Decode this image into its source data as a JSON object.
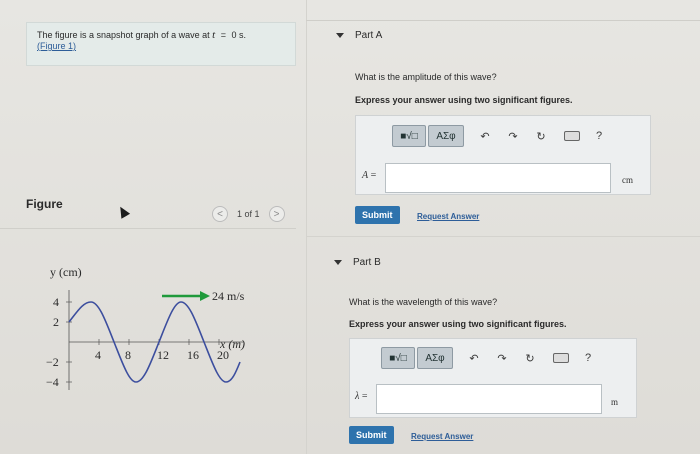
{
  "problem": {
    "text_prefix": "The figure is a snapshot graph of a wave at",
    "t_var": "t",
    "eq": "=",
    "t_value": "0 s.",
    "figure_link": "(Figure 1)"
  },
  "figure": {
    "label": "Figure",
    "pager": {
      "prev": "<",
      "count": "1 of 1",
      "next": ">"
    },
    "graph": {
      "y_axis_label": "y (cm)",
      "x_axis_label": "x (m)",
      "speed_label": "24 m/s",
      "y_ticks": [
        "4",
        "2",
        "−2",
        "−4"
      ],
      "x_ticks": [
        "4",
        "8",
        "12",
        "16",
        "20"
      ]
    }
  },
  "partA": {
    "header": "Part A",
    "question": "What is the amplitude of this wave?",
    "instruction": "Express your answer using two significant figures.",
    "toolbar": {
      "templates": "■√□",
      "symbols": "AΣφ",
      "help": "?"
    },
    "var": "A",
    "eq": "=",
    "unit": "cm",
    "input_value": "",
    "submit": "Submit",
    "request": "Request Answer"
  },
  "partB": {
    "header": "Part B",
    "question": "What is the wavelength of this wave?",
    "instruction": "Express your answer using two significant figures.",
    "toolbar": {
      "templates": "■√□",
      "symbols": "AΣφ",
      "help": "?"
    },
    "var": "λ",
    "eq": "=",
    "unit": "m",
    "input_value": "",
    "submit": "Submit",
    "request": "Request Answer"
  },
  "colors": {
    "accent": "#2e73ad",
    "link": "#2d5d98",
    "wave": "#3c4e9e",
    "arrow": "#1f9a3b"
  }
}
